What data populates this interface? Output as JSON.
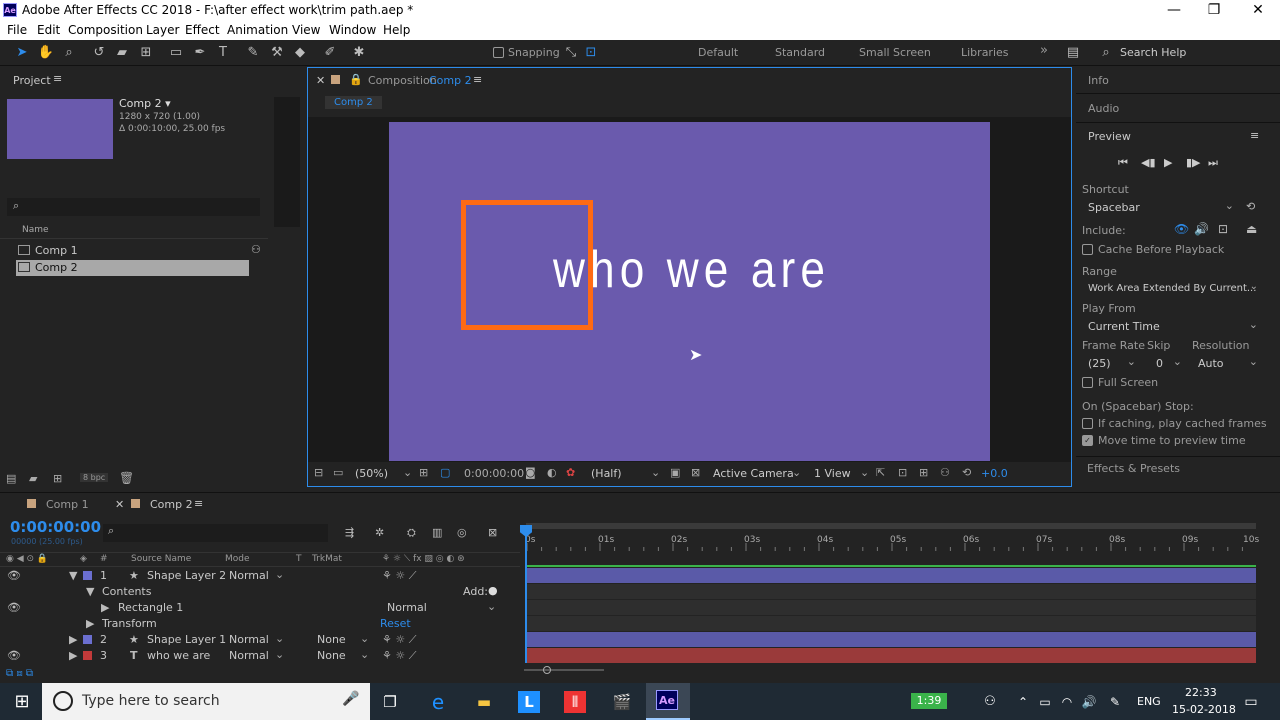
{
  "app": {
    "title": "Adobe After Effects CC 2018 - F:\\after effect work\\trim path.aep *",
    "icon_text": "Ae",
    "min": "—",
    "max": "❐",
    "close": "✕"
  },
  "menu": [
    "File",
    "Edit",
    "Composition",
    "Layer",
    "Effect",
    "Animation",
    "View",
    "Window",
    "Help"
  ],
  "toolbar": {
    "snapping": "Snapping",
    "workspaces": [
      "Default",
      "Standard",
      "Small Screen",
      "Libraries"
    ],
    "more": "»",
    "search": "Search Help"
  },
  "project": {
    "tab": "Project",
    "selected_name": "Comp 2 ▾",
    "info1": "1280 x 720 (1.00)",
    "info2": "Δ 0:00:10:00, 25.00 fps",
    "search_icon": "⌕",
    "col_name": "Name",
    "items": [
      "Comp 1",
      "Comp 2"
    ],
    "bpc": "8 bpc",
    "thumb_color": "#6a5aad"
  },
  "composition": {
    "tab_label": "Composition",
    "tab_name": "Comp 2",
    "crumb": "Comp 2",
    "canvas_color": "#6a5aad",
    "text": "who we are",
    "rect_color": "#ff6a13"
  },
  "viewer_footer": {
    "zoom": "(50%)",
    "time": "0:00:00:00",
    "res": "(Half)",
    "camera": "Active Camera",
    "views": "1 View",
    "exposure": "+0.0"
  },
  "right": {
    "info": "Info",
    "audio": "Audio",
    "preview": "Preview",
    "shortcut_lbl": "Shortcut",
    "shortcut": "Spacebar",
    "include_lbl": "Include:",
    "cache": "Cache Before Playback",
    "range_lbl": "Range",
    "range": "Work Area Extended By Current...",
    "playfrom_lbl": "Play From",
    "playfrom": "Current Time",
    "fr_lbl": "Frame Rate",
    "skip_lbl": "Skip",
    "res_lbl": "Resolution",
    "fr": "(25)",
    "skip": "0",
    "res": "Auto",
    "fullscreen": "Full Screen",
    "stop_lbl": "On (Spacebar) Stop:",
    "ifcache": "If caching, play cached frames",
    "movetime": "Move time to preview time",
    "effects": "Effects & Presets"
  },
  "timeline": {
    "tabs": [
      "Comp 1",
      "Comp 2"
    ],
    "timecode": "0:00:00:00",
    "sub": "00000 (25.00 fps)",
    "col_num": "#",
    "col_source": "Source Name",
    "col_mode": "Mode",
    "col_t": "T",
    "col_trkmat": "TrkMat",
    "ruler": [
      "0s",
      "01s",
      "02s",
      "03s",
      "04s",
      "05s",
      "06s",
      "07s",
      "08s",
      "09s",
      "10s"
    ],
    "layers": [
      {
        "num": "1",
        "name": "Shape Layer 2",
        "mode": "Normal",
        "trk": "",
        "color": "#6b6fd0",
        "bar": "#5a5aa8"
      },
      {
        "num": "2",
        "name": "Shape Layer 1",
        "mode": "Normal",
        "trk": "None",
        "color": "#6b6fd0",
        "bar": "#5a5aa8"
      },
      {
        "num": "3",
        "name": "who we are",
        "mode": "Normal",
        "trk": "None",
        "color": "#c23a3a",
        "bar": "#9a3a3a"
      }
    ],
    "contents": "Contents",
    "add": "Add:",
    "rect": "Rectangle 1",
    "rect_mode": "Normal",
    "transform": "Transform",
    "reset": "Reset"
  },
  "taskbar": {
    "search": "Type here to search",
    "battery": "1:39",
    "lang": "ENG",
    "time": "22:33",
    "date": "15-02-2018"
  }
}
